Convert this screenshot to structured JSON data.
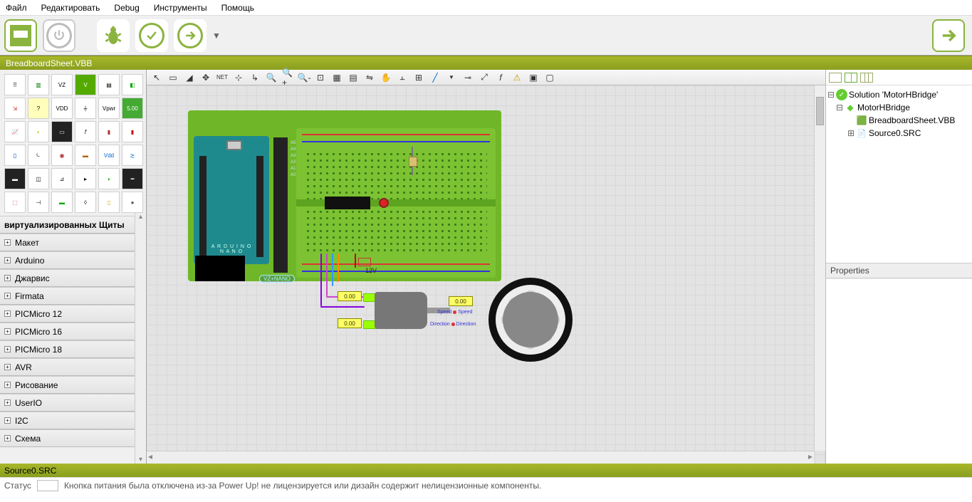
{
  "menu": {
    "items": [
      "Файл",
      "Редактировать",
      "Debug",
      "Инструменты",
      "Помощь"
    ]
  },
  "tabs": {
    "top": "BreadboardSheet.VBB",
    "bottom": "Source0.SRC"
  },
  "left_panel": {
    "header": "виртуализированных Щиты",
    "categories": [
      "Макет",
      "Arduino",
      "Джарвис",
      "Firmata",
      "PICMicro 12",
      "PICMicro 16",
      "PICMicro 18",
      "AVR",
      "Рисование",
      "UserIO",
      "I2C",
      "Схема"
    ]
  },
  "solution": {
    "root": "Solution 'MotorHBridge'",
    "project": "MotorHBridge",
    "items": [
      "BreadboardSheet.VBB",
      "Source0.SRC"
    ]
  },
  "properties": {
    "title": "Properties"
  },
  "canvas": {
    "arduino_label": "A R D U I N O\nN A N O",
    "badge": "VZ+NANO",
    "analog_labels": "A5\nA4\nA3\nA2\nA1\nA0",
    "voltage_label": "12V",
    "meter": "0.00",
    "motor_labels": {
      "speed": "Speed",
      "direction": "Direction"
    }
  },
  "status": {
    "label": "Статус",
    "value": "",
    "message": "Кнопка питания была отключена из-за Power Up! не лицензируется или дизайн содержит нелицензионные компоненты."
  },
  "palette_labels": {
    "vdd": "VDD",
    "vpwr": "Vpwr",
    "num": "5.00",
    "vdd2": "Vdd"
  }
}
